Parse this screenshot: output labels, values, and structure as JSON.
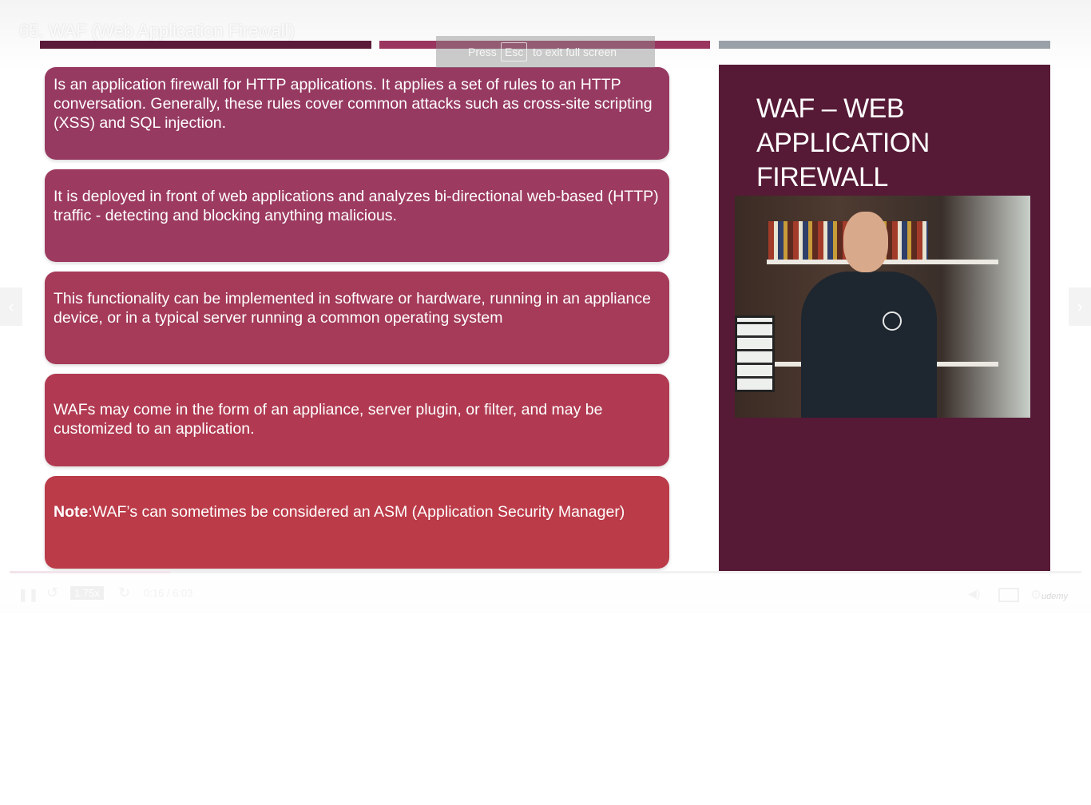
{
  "lecture_title": "65. WAF (Web Application Firewall)",
  "fullscreen_hint": {
    "press": "Press",
    "key": "Esc",
    "rest": "to exit full screen"
  },
  "slide": {
    "title": "WAF – WEB APPLICATION FIREWALL",
    "colors": {
      "dark_bar": "#5c1a3a",
      "mid_bar": "#9a3560",
      "grey_bar": "#9aa1a8",
      "panel": "#561a36"
    },
    "points": [
      "Is an application firewall for HTTP applications. It applies a set of rules to an HTTP conversation. Generally, these rules cover common attacks such as cross-site scripting (XSS) and SQL injection.",
      "It is deployed in front of web applications and analyzes bi-directional web-based (HTTP) traffic - detecting and blocking anything malicious.",
      "This functionality can be implemented in software or hardware, running in an appliance device, or in a typical server running a common operating system",
      "WAFs may come in the form of an appliance, server plugin, or filter, and may be customized to an application."
    ],
    "note": {
      "label": "Note",
      "text": ":WAF’s can sometimes be considered an ASM (Application Security Manager)"
    }
  },
  "player": {
    "speed": "1.75x",
    "time": "0:16 / 6:03",
    "progress": 0.15,
    "brand": "udemy",
    "icons": {
      "play": "pause-icon",
      "rewind": "rewind-icon",
      "forward": "forward-icon",
      "volume": "volume-icon",
      "captions": "captions-icon",
      "settings": "settings-icon",
      "prev": "chevron-left-icon",
      "next": "chevron-right-icon"
    }
  }
}
